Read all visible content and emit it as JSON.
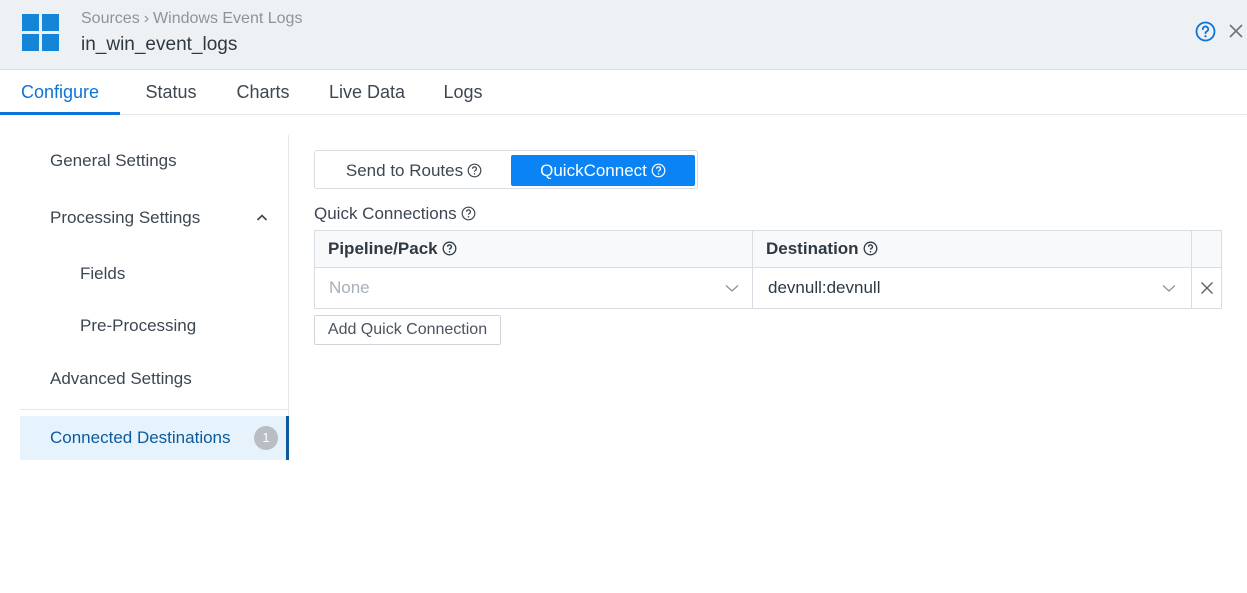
{
  "header": {
    "breadcrumb": [
      "Sources",
      "Windows Event Logs"
    ],
    "breadcrumb_separator": "›",
    "title": "in_win_event_logs",
    "icons": {
      "logo": "windows-logo-icon",
      "help": "help-circle-icon",
      "close": "close-icon"
    },
    "brand_color": "#1585d8"
  },
  "tabs": [
    {
      "label": "Configure",
      "active": true
    },
    {
      "label": "Status",
      "active": false
    },
    {
      "label": "Charts",
      "active": false
    },
    {
      "label": "Live Data",
      "active": false
    },
    {
      "label": "Logs",
      "active": false
    }
  ],
  "sidebar": {
    "items": [
      {
        "label": "General Settings"
      },
      {
        "label": "Processing Settings",
        "expanded": true,
        "icon": "chevron-up-icon"
      },
      {
        "label": "Fields"
      },
      {
        "label": "Pre-Processing"
      },
      {
        "label": "Advanced Settings"
      },
      {
        "label": "Connected Destinations",
        "active": true,
        "badge": "1"
      }
    ]
  },
  "main": {
    "toggle": {
      "options": [
        {
          "label": "Send to Routes",
          "selected": false
        },
        {
          "label": "QuickConnect",
          "selected": true
        }
      ],
      "accent": "#0a84f5"
    },
    "quick_connections_label": "Quick Connections",
    "table": {
      "columns": [
        "Pipeline/Pack",
        "Destination"
      ],
      "rows": [
        {
          "pipeline": "None",
          "destination": "devnull:devnull"
        }
      ]
    },
    "add_button": "Add Quick Connection"
  }
}
